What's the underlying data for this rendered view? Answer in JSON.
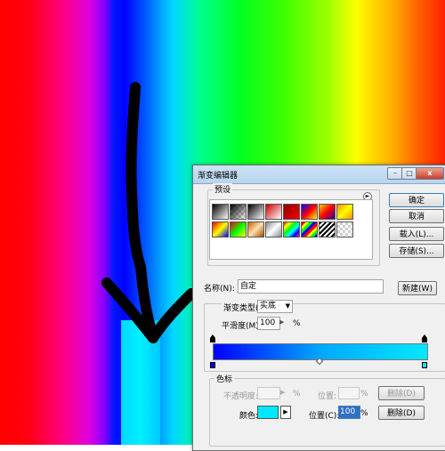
{
  "dialog": {
    "title": "渐变编辑器",
    "window_buttons": {
      "minimize": "–",
      "maximize": "□",
      "close": "x"
    },
    "presets": {
      "label": "预设",
      "menu_icon": "►"
    },
    "buttons": {
      "ok": "确定",
      "cancel": "取消",
      "load": "载入(L)...",
      "save": "存储(S)...",
      "new": "新建(W)"
    },
    "name": {
      "label": "名称(N):",
      "value": "自定"
    },
    "gradient": {
      "type_label": "渐变类型(T):",
      "type_value": "实底",
      "smoothness_label": "平滑度(M):",
      "smoothness_value": "100",
      "smoothness_unit": "%",
      "colors": {
        "start": "#0000ff",
        "end": "#00e8ff"
      }
    },
    "stops": {
      "label": "色标",
      "opacity_label": "不透明度:",
      "opacity_unit": "%",
      "location_label": "位置:",
      "location_unit": "%",
      "delete_label": "删除(D)",
      "color_label": "颜色:",
      "color_value": "#00e8ff",
      "location2_label": "位置(C):",
      "location2_value": "100",
      "location2_unit": "%",
      "delete2_label": "删除(D)"
    }
  },
  "icons": {
    "arrow_annotation": "hand-drawn-down-arrow",
    "presets_menu": "circle-arrow-icon",
    "dropdown": "chevron-down-icon"
  }
}
